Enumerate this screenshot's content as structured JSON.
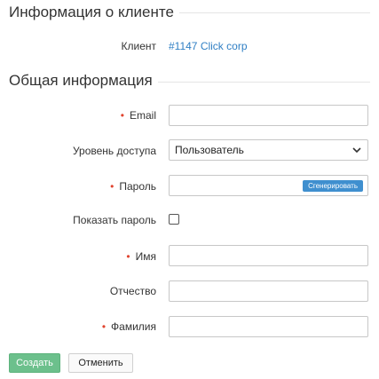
{
  "client_section": {
    "title": "Информация о клиенте",
    "client_label": "Клиент",
    "client_value": "#1147 Click corp"
  },
  "general_section": {
    "title": "Общая информация",
    "email_label": "Email",
    "email_value": "",
    "access_label": "Уровень доступа",
    "access_value": "Пользователь",
    "password_label": "Пароль",
    "password_value": "",
    "generate_label": "Сгенерировать",
    "show_password_label": "Показать пароль",
    "show_password_checked": false,
    "first_name_label": "Имя",
    "first_name_value": "",
    "patronymic_label": "Отчество",
    "patronymic_value": "",
    "last_name_label": "Фамилия",
    "last_name_value": ""
  },
  "actions": {
    "create_label": "Создать",
    "cancel_label": "Отменить"
  },
  "colors": {
    "accent_link": "#2f7fc4",
    "required_marker": "#e0442f",
    "create_button": "#6cc08c",
    "generate_button": "#3f8fcf"
  }
}
